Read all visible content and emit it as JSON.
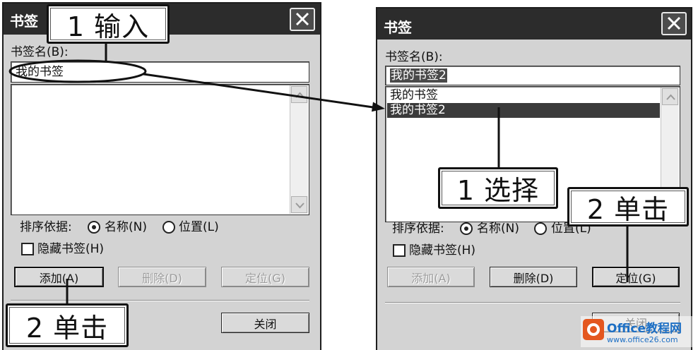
{
  "colors": {
    "title_bar": "#2c2c2c",
    "dialog_bg": "#d3d3d3",
    "selection": "#3b3b3b",
    "watermark_orange": "#e4571f",
    "watermark_blue": "#1d6fc4"
  },
  "left_dialog": {
    "title": "书签",
    "close_icon": "close-x-icon",
    "name_label": "书签名(B):",
    "name_value": "我的书签",
    "list_items": [],
    "sort_label": "排序依据:",
    "sort_options": [
      {
        "label": "名称(N)",
        "selected": true
      },
      {
        "label": "位置(L)",
        "selected": false
      }
    ],
    "hide_label": "隐藏书签(H)",
    "hide_checked": false,
    "buttons": {
      "add": {
        "label": "添加(A)",
        "enabled": true
      },
      "delete": {
        "label": "删除(D)",
        "enabled": false
      },
      "goto": {
        "label": "定位(G)",
        "enabled": false
      },
      "close": {
        "label": "关闭",
        "enabled": true
      }
    }
  },
  "right_dialog": {
    "title": "书签",
    "close_icon": "close-x-icon",
    "name_label": "书签名(B):",
    "name_value": "我的书签2",
    "name_value_selected": true,
    "list_items": [
      {
        "label": "我的书签",
        "selected": false
      },
      {
        "label": "我的书签2",
        "selected": true
      }
    ],
    "sort_label": "排序依据:",
    "sort_options": [
      {
        "label": "名称(N)",
        "selected": true
      },
      {
        "label": "位置(L)",
        "selected": false
      }
    ],
    "hide_label": "隐藏书签(H)",
    "hide_checked": false,
    "buttons": {
      "add": {
        "label": "添加(A)",
        "enabled": false
      },
      "delete": {
        "label": "删除(D)",
        "enabled": true
      },
      "goto": {
        "label": "定位(G)",
        "enabled": true
      },
      "close": {
        "label": "关闭",
        "enabled": true
      }
    }
  },
  "callouts": {
    "left_step1": "1 输入",
    "left_step2": "2 单击",
    "right_step1": "1 选择",
    "right_step2": "2 单击"
  },
  "watermark": {
    "brand": "Office教程网",
    "url": "www.office26.com"
  }
}
